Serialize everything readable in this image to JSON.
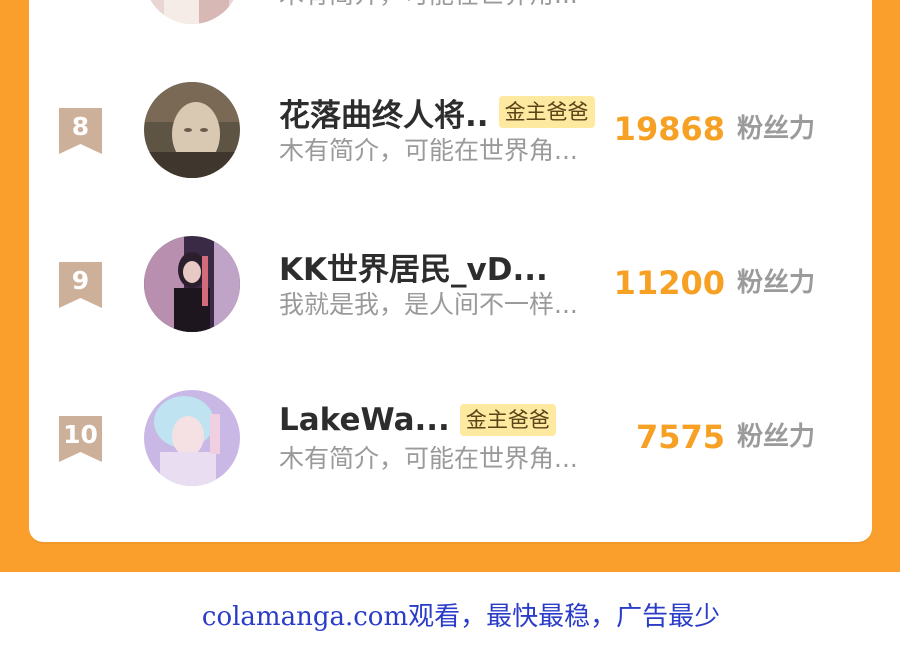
{
  "leaderboard": {
    "previous_row": {
      "intro": "木有简介，可能在世界角..."
    },
    "unit_label": "粉丝力",
    "rows": [
      {
        "rank": "8",
        "name": "花落曲终人将..",
        "badge": "金主爸爸",
        "intro": "木有简介，可能在世界角...",
        "score": "19868"
      },
      {
        "rank": "9",
        "name": "KK世界居民_vD...",
        "badge": "",
        "intro": "我就是我，是人间不一样...",
        "score": "11200"
      },
      {
        "rank": "10",
        "name": "LakeWa...",
        "badge": "金主爸爸",
        "intro": "木有简介，可能在世界角...",
        "score": "7575"
      }
    ]
  },
  "footer": {
    "text": "colamanga.com观看，最快最稳，广告最少"
  },
  "colors": {
    "accent": "#fb9f2c",
    "score": "#f6a024",
    "badge_bg": "#fde9a0",
    "footer_link": "#2a3cc8"
  },
  "icons": {
    "rank_flag": "rank-ribbon-icon"
  }
}
